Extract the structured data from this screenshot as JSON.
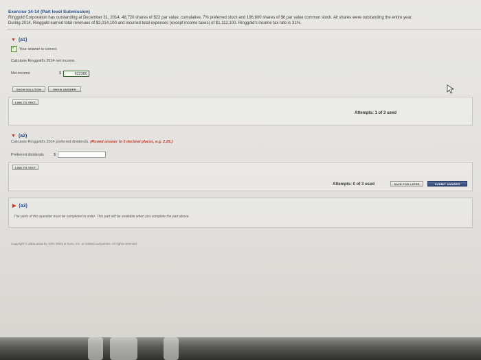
{
  "header": {
    "title": "Exercise 14-14 (Part level Submission)",
    "line1": "Ringgold Corporation has outstanding at December 31, 2014, 48,720 shares of $22 par value, cumulative, 7% preferred stock and 196,800 shares of $6 par value common stock. All shares were outstanding the entire year.",
    "line2": "During 2014, Ringgold earned total revenues of $2,014,100 and incurred total expenses (except income taxes) of $1,112,100. Ringgold's income tax rate is 31%."
  },
  "part_a1": {
    "label": "(a1)",
    "correct_msg": "Your answer is correct.",
    "question": "Calculate Ringgold's 2014 net income.",
    "field_label": "Net income",
    "currency": "$",
    "value": "622380",
    "btn_solution": "SHOW SOLUTION",
    "btn_answer": "SHOW ANSWER",
    "btn_link": "LINK TO TEXT",
    "attempts": "Attempts: 1 of 3 used"
  },
  "part_a2": {
    "label": "(a2)",
    "question": "Calculate Ringgold's 2014 preferred dividends.",
    "hint": "(Round answer to 0 decimal places, e.g. 2.25.)",
    "field_label": "Preferred dividends",
    "currency": "$",
    "value": "",
    "btn_link": "LINK TO TEXT",
    "attempts": "Attempts: 0 of 3 used",
    "btn_save": "SAVE FOR LATER",
    "btn_submit": "SUBMIT ANSWER"
  },
  "part_a3": {
    "label": "(a3)",
    "note": "The parts of this question must be completed in order. This part will be available when you complete the part above."
  },
  "footer": {
    "copyright": "Copyright © 2000-2018 by John Wiley & Sons, Inc. or related companies. All rights reserved."
  },
  "colors": {
    "accent": "#2a4f86",
    "alert": "#c0392b",
    "submit": "#2f4576"
  }
}
